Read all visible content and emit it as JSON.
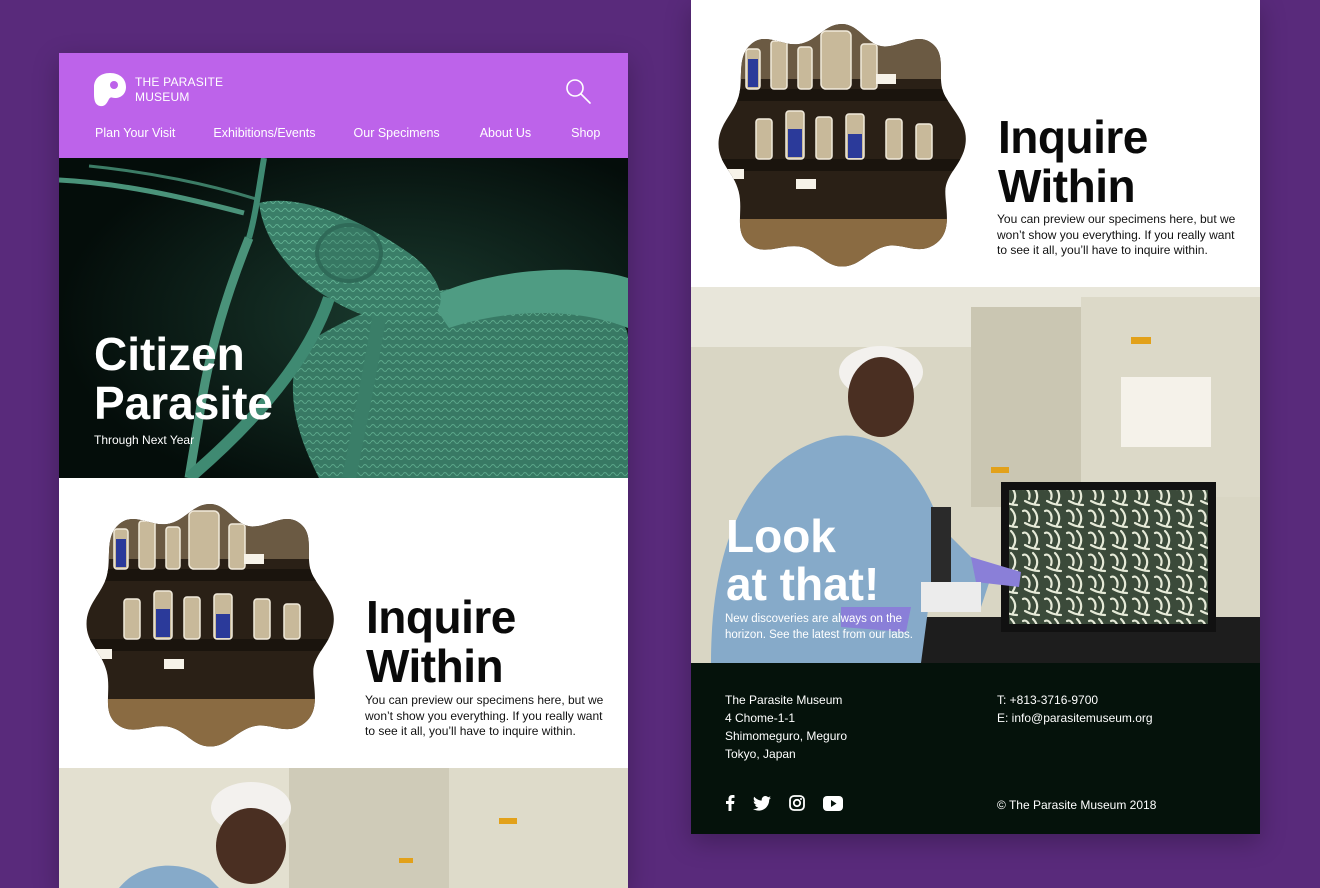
{
  "site": {
    "logo_line1": "THE PARASITE",
    "logo_line2": "MUSEUM"
  },
  "nav": {
    "items": [
      "Plan Your Visit",
      "Exhibitions/Events",
      "Our Specimens",
      "About Us",
      "Shop"
    ]
  },
  "hero": {
    "title_line1": "Citizen",
    "title_line2": "Parasite",
    "subtitle": "Through Next Year"
  },
  "inquire": {
    "title_line1": "Inquire",
    "title_line2": "Within",
    "body": "You can preview our specimens here, but we won’t show you everything. If you  really want to see it all, you’ll have to inquire within."
  },
  "lab": {
    "title_line1": "Look",
    "title_line2": "at that!",
    "body": "New discoveries are always on the horizon. See the latest from our labs."
  },
  "footer": {
    "address": [
      "The Parasite Museum",
      "4 Chome-1-1",
      "Shimomeguro, Meguro",
      "Tokyo, Japan"
    ],
    "phone": "T: +813-3716-9700",
    "email": "E: info@parasitemuseum.org",
    "copyright": "© The Parasite Museum 2018",
    "social_icons": [
      "facebook-icon",
      "twitter-icon",
      "instagram-icon",
      "youtube-icon"
    ]
  },
  "colors": {
    "background": "#592a7b",
    "header": "#bd63ea",
    "footer": "#05120b",
    "hero_insect": "#3f8a72"
  }
}
